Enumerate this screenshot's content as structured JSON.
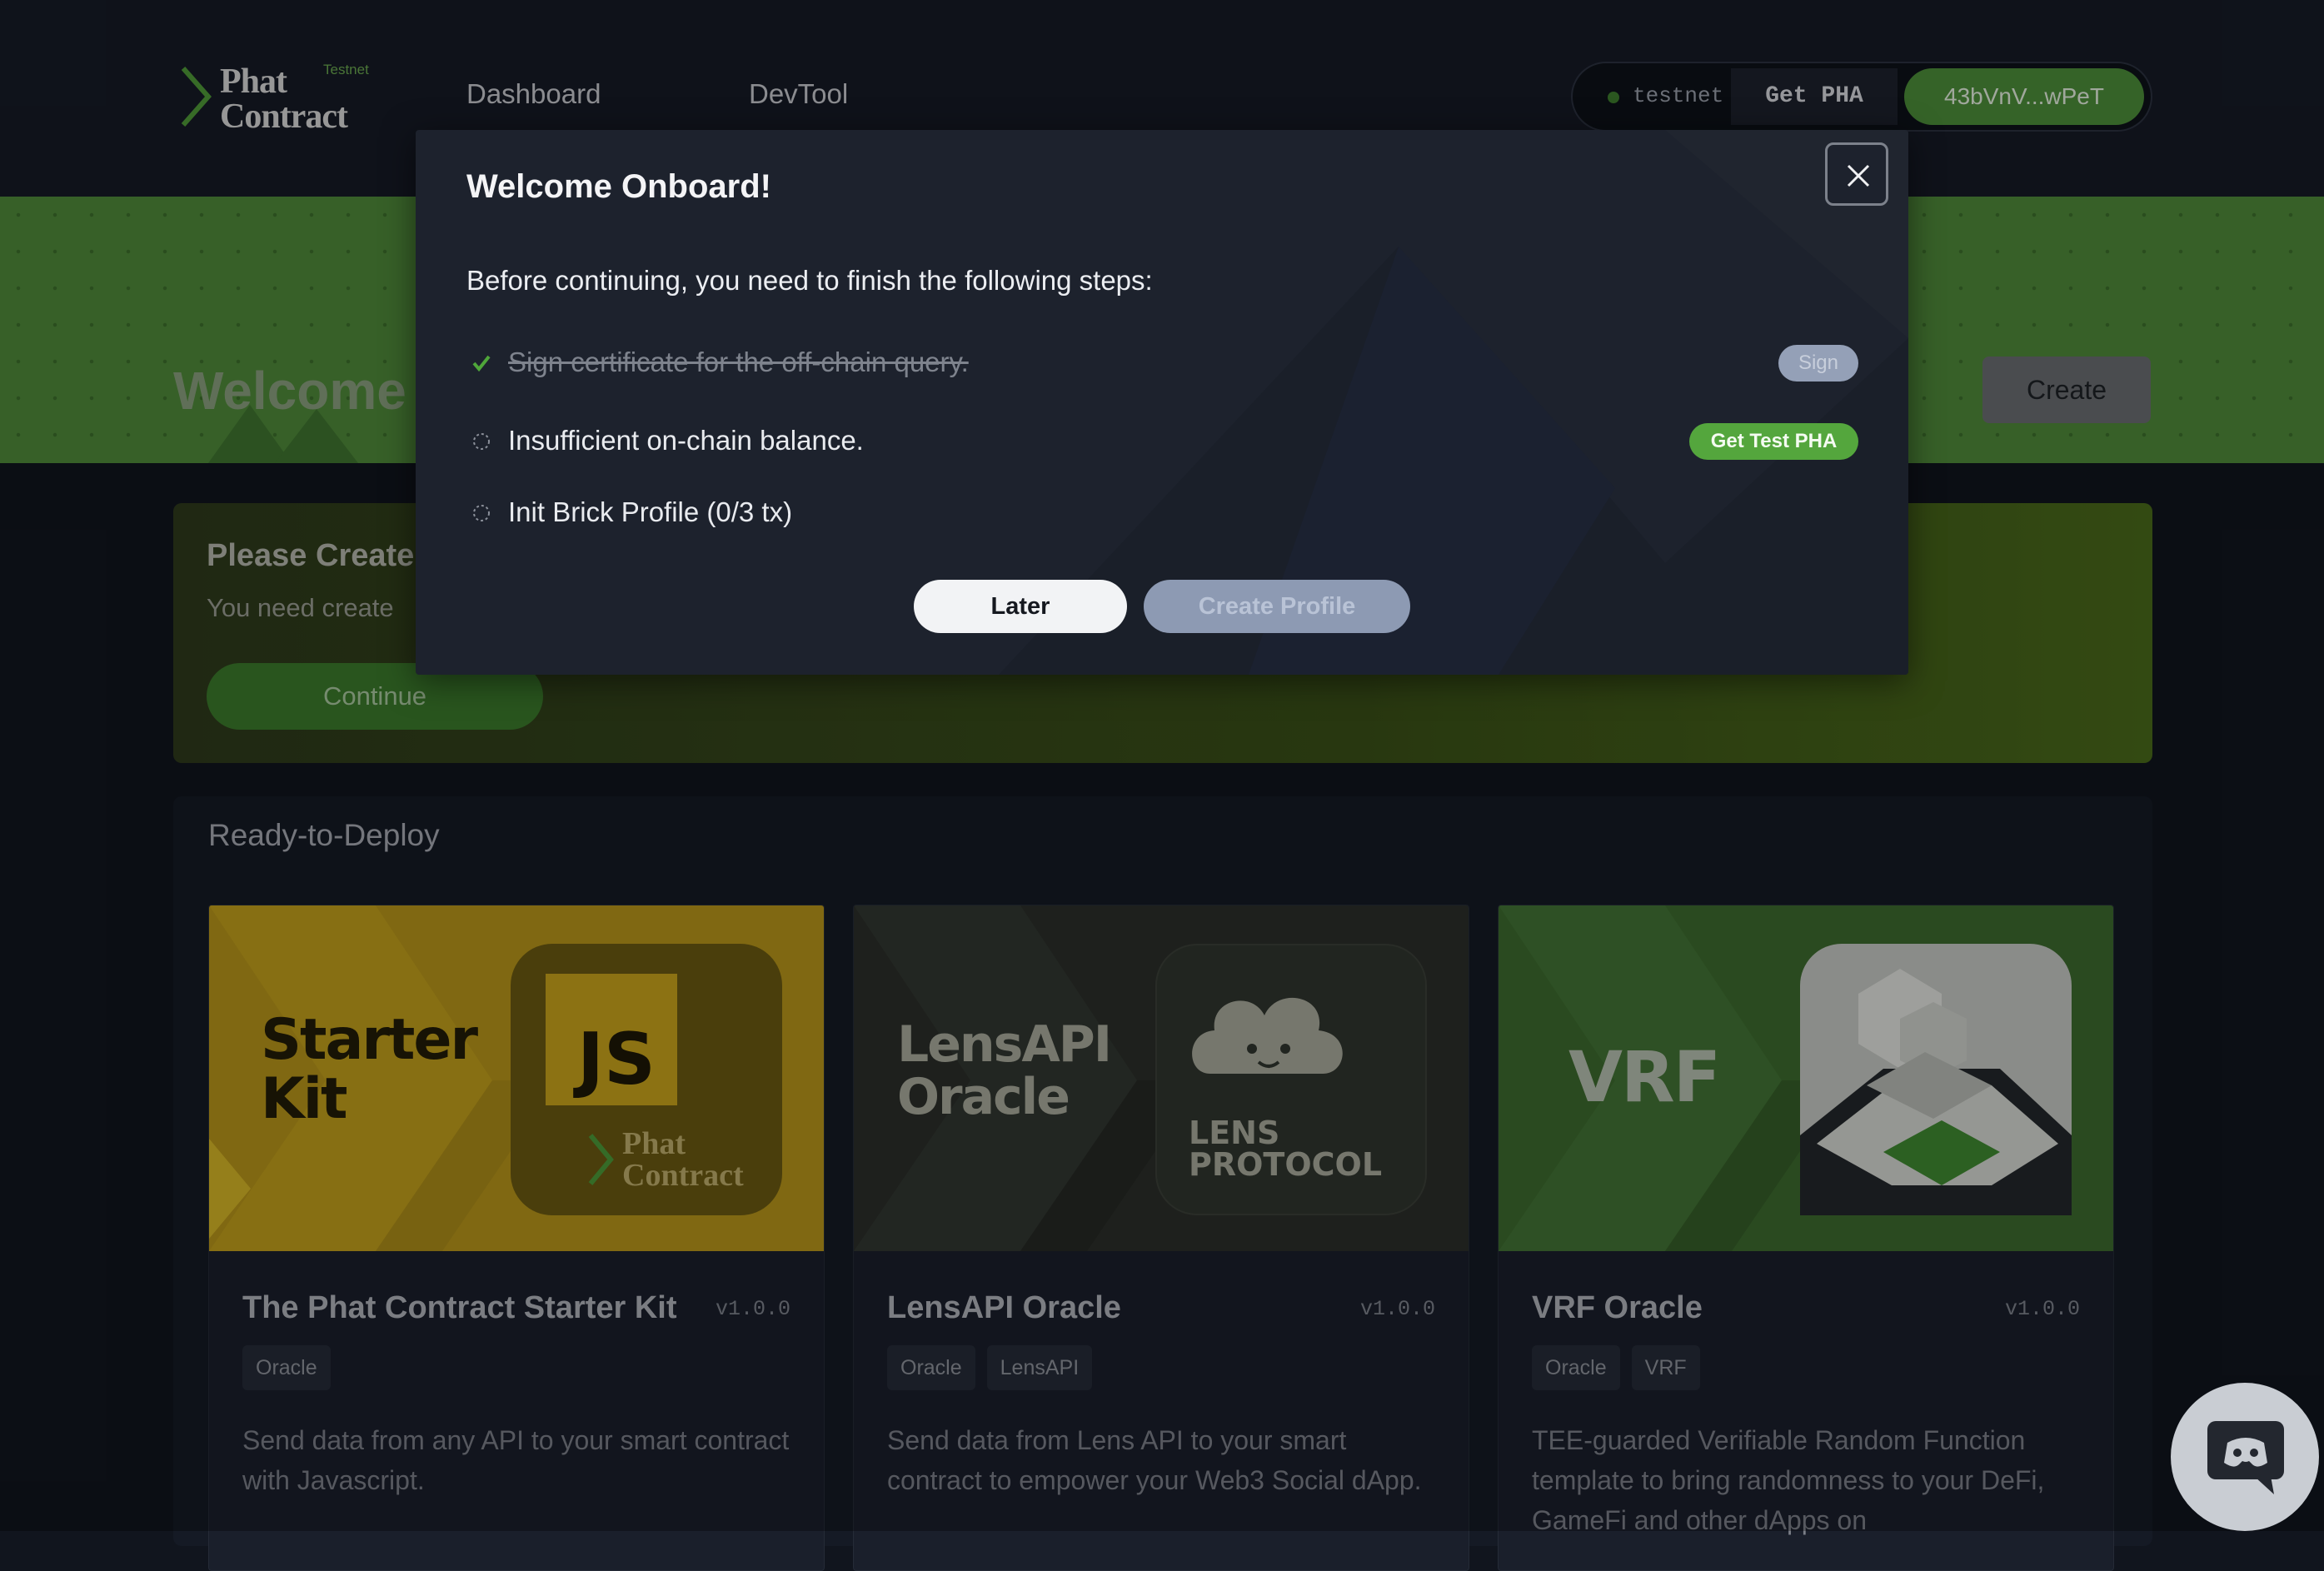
{
  "header": {
    "logo": {
      "line1": "Phat",
      "line2": "Contract",
      "badge": "Testnet"
    },
    "nav": [
      {
        "label": "Dashboard"
      },
      {
        "label": "DevTool"
      }
    ],
    "wallet": {
      "network": "testnet",
      "get_pha": "Get PHA",
      "address": "43bVnV...wPeT"
    }
  },
  "banner": {
    "title": "Welcome",
    "create_label": "Create"
  },
  "please_create": {
    "title": "Please Create",
    "text": "You need create",
    "button": "Continue"
  },
  "ready_to_deploy": {
    "title": "Ready-to-Deploy",
    "cards": [
      {
        "art_text": [
          "Starter",
          "Kit"
        ],
        "art_badge": "JS",
        "art_logo": [
          "Phat",
          "Contract"
        ],
        "title": "The Phat Contract Starter Kit",
        "version": "v1.0.0",
        "tags": [
          "Oracle"
        ],
        "description": "Send data from any API to your smart contract with Javascript."
      },
      {
        "art_text": [
          "LensAPI",
          "Oracle"
        ],
        "art_logo": [
          "LENS",
          "PROTOCOL"
        ],
        "title": "LensAPI Oracle",
        "version": "v1.0.0",
        "tags": [
          "Oracle",
          "LensAPI"
        ],
        "description": "Send data from Lens API to your smart contract to empower your Web3 Social dApp."
      },
      {
        "art_text": [
          "VRF"
        ],
        "title": "VRF Oracle",
        "version": "v1.0.0",
        "tags": [
          "Oracle",
          "VRF"
        ],
        "description": "TEE-guarded Verifiable Random Function template to bring randomness to your DeFi, GameFi and other dApps on"
      }
    ]
  },
  "modal": {
    "title": "Welcome Onboard!",
    "intro": "Before continuing, you need to finish the following steps:",
    "steps": [
      {
        "label": "Sign certificate for the off-chain query.",
        "status": "done",
        "action": "Sign"
      },
      {
        "label": "Insufficient on-chain balance.",
        "status": "pending",
        "action": "Get Test PHA"
      },
      {
        "label": "Init Brick Profile (0/3 tx)",
        "status": "pending",
        "action": ""
      }
    ],
    "later": "Later",
    "create_profile": "Create Profile"
  },
  "colors": {
    "accent_green": "#54a63d",
    "banner_green": "#4f8a3a",
    "modal_bg": "#1d222d",
    "page_bg": "#11151e"
  },
  "icons": [
    "phat-logo-chevron-icon",
    "close-icon",
    "check-icon",
    "pending-circle-icon",
    "discord-icon"
  ]
}
